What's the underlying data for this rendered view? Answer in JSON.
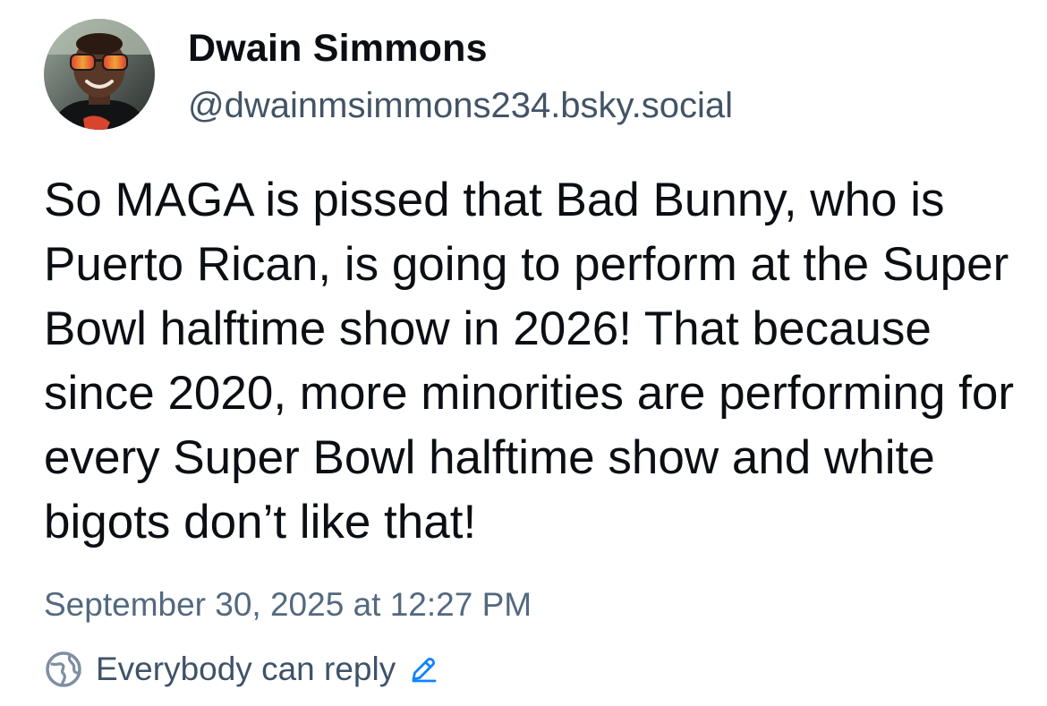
{
  "author": {
    "display_name": "Dwain Simmons",
    "handle": "@dwainmsimmons234.bsky.social",
    "avatar_icon": "profile-photo"
  },
  "post": {
    "text": "So MAGA is pissed that Bad Bunny, who is Puerto Rican, is going to perform at the Super Bowl halftime show in 2026! That because since 2020, more minorities are performing for every Super Bowl halftime show and white bigots don’t like that!",
    "timestamp": "September 30, 2025 at 12:27 PM"
  },
  "reply_settings": {
    "label": "Everybody can reply",
    "globe_icon": "globe-icon",
    "edit_icon": "pencil-icon"
  },
  "colors": {
    "text": "#0b0f14",
    "secondary": "#425466",
    "accent": "#1083fe"
  }
}
